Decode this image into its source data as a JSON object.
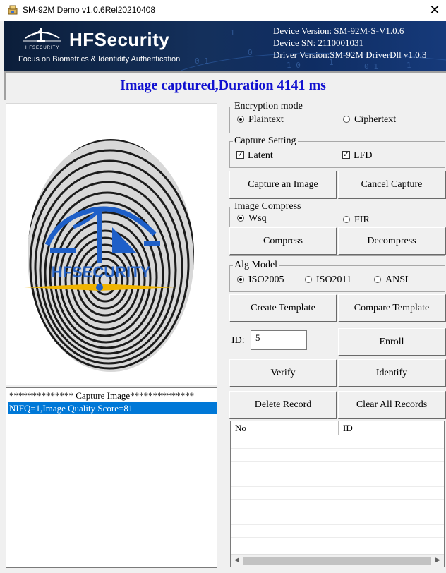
{
  "window": {
    "title": "SM-92M Demo v1.0.6Rel20210408",
    "close_glyph": "✕"
  },
  "banner": {
    "small_brand": "HFSECURITY",
    "brand": "HFSecurity",
    "tagline": "Focus on Biometrics & Identidity Authentication",
    "device_version": "Device Version: SM-92M-S-V1.0.6",
    "device_sn": "Device SN: 2110001031",
    "driver_version": "Driver Version:SM-92M DriverDll v1.0.3"
  },
  "status": "Image captured,Duration 4141 ms",
  "fingerprint": {
    "watermark_text": "HFSECURITY"
  },
  "log": {
    "lines": [
      "************** Capture Image**************",
      "NIFQ=1,Image Quality Score=81"
    ],
    "selected_index": 1
  },
  "encryption": {
    "legend": "Encryption mode",
    "options": [
      "Plaintext",
      "Ciphertext"
    ],
    "selected": "Plaintext"
  },
  "capture_setting": {
    "legend": "Capture Setting",
    "latent": {
      "label": "Latent",
      "checked": true
    },
    "lfd": {
      "label": "LFD",
      "checked": true
    }
  },
  "buttons": {
    "capture": "Capture an Image",
    "cancel_capture": "Cancel Capture",
    "compress": "Compress",
    "decompress": "Decompress",
    "create_template": "Create Template",
    "compare_template": "Compare Template",
    "enroll": "Enroll",
    "verify": "Verify",
    "identify": "Identify",
    "delete_record": "Delete Record",
    "clear_all": "Clear All Records"
  },
  "image_compress": {
    "legend": "Image Compress",
    "options": [
      "Wsq",
      "FIR"
    ],
    "selected": "Wsq"
  },
  "alg_model": {
    "legend": "Alg Model",
    "options": [
      "ISO2005",
      "ISO2011",
      "ANSI"
    ],
    "selected": "ISO2005"
  },
  "id_field": {
    "label": "ID:",
    "value": "5"
  },
  "records": {
    "columns": [
      "No",
      "ID"
    ],
    "rows": []
  },
  "colors": {
    "status_text": "#1010d0",
    "selection": "#0078d7",
    "banner_dark": "#0b1e3a",
    "logo_gold": "#f0b400",
    "logo_blue": "#1e5fc8"
  }
}
